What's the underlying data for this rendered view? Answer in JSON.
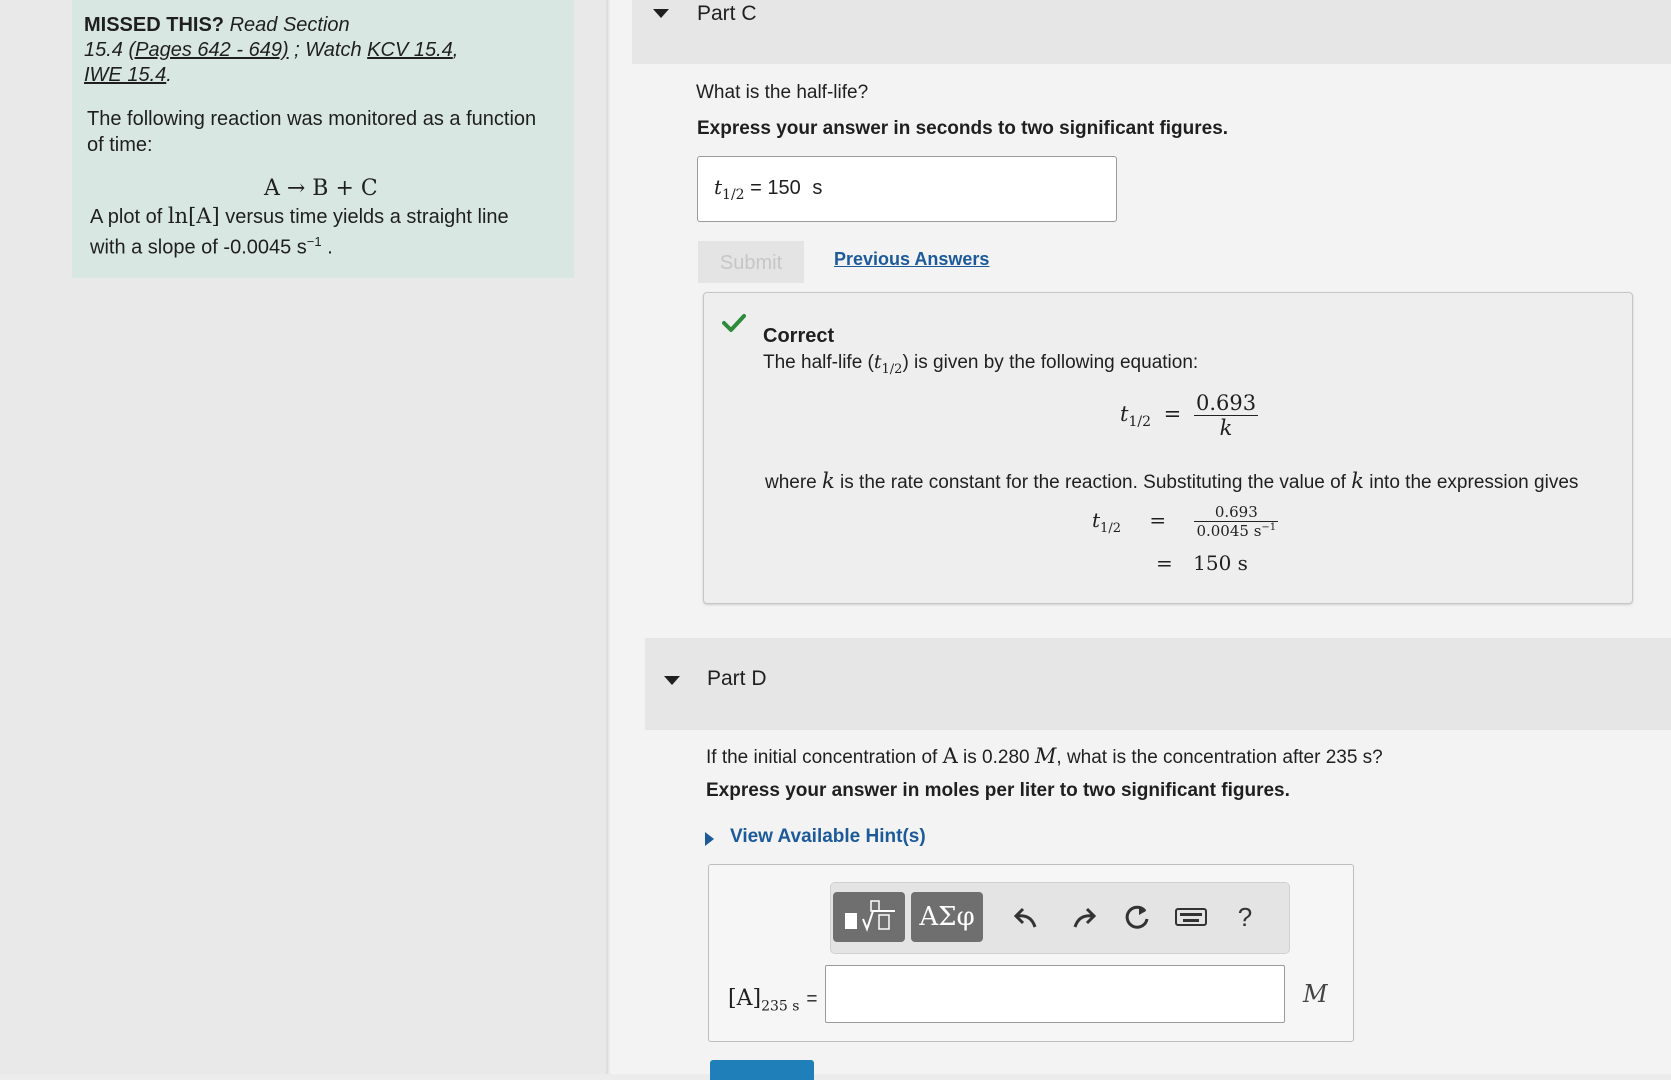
{
  "intro": {
    "missed": "MISSED THIS?",
    "read_section": "Read Section",
    "section_num": "15.4",
    "pages_link": "(Pages 642 - 649)",
    "watch_sep": "; Watch",
    "kcv_link": "KCV 15.4",
    "iwe_link": "IWE 15.4",
    "desc_line1": "The following reaction was monitored as a function",
    "desc_line2": "of time:",
    "reaction": "A → B + C",
    "plot_pre": "A plot of",
    "plot_ln": "ln[A]",
    "plot_post": "versus time yields a straight line",
    "slope_text": "with a slope of -0.0045 s",
    "slope_exp": "−1",
    "slope_end": "."
  },
  "part_c": {
    "title": "Part C",
    "question": "What is the half-life?",
    "instruction": "Express your answer in seconds to two significant figures.",
    "answer_label_var": "t",
    "answer_label_sub": "1/2",
    "answer_eq": "=",
    "answer_value": "150",
    "answer_unit": "s",
    "submit_label": "Submit",
    "previous_answers_label": "Previous Answers",
    "feedback": {
      "status": "Correct",
      "line1_pre": "The half-life (",
      "line1_var": "t",
      "line1_sub": "1/2",
      "line1_post": ") is given by the following equation:",
      "eq1_num": "0.693",
      "eq1_den": "k",
      "line2_pre": "where",
      "line2_var": "k",
      "line2_mid": "is the rate constant for the reaction. Substituting the value of",
      "line2_var2": "k",
      "line2_post": "into the expression gives",
      "eq2_num": "0.693",
      "eq2_den": "0.0045 s",
      "eq2_den_exp": "−1",
      "eq2_result": "150 s"
    }
  },
  "part_d": {
    "title": "Part D",
    "question_pre": "If the initial concentration of",
    "question_var": "A",
    "question_mid": "is 0.280",
    "question_unit": "M",
    "question_post": ", what is the concentration after 235 s?",
    "instruction": "Express your answer in moles per liter to two significant figures.",
    "hint_label": "View Available Hint(s)",
    "toolbar": {
      "greek_label": "ΑΣφ",
      "help_label": "?"
    },
    "input_label_base": "[A]",
    "input_label_sub": "235 s",
    "input_label_eq": "=",
    "input_value": "",
    "unit": "M"
  }
}
